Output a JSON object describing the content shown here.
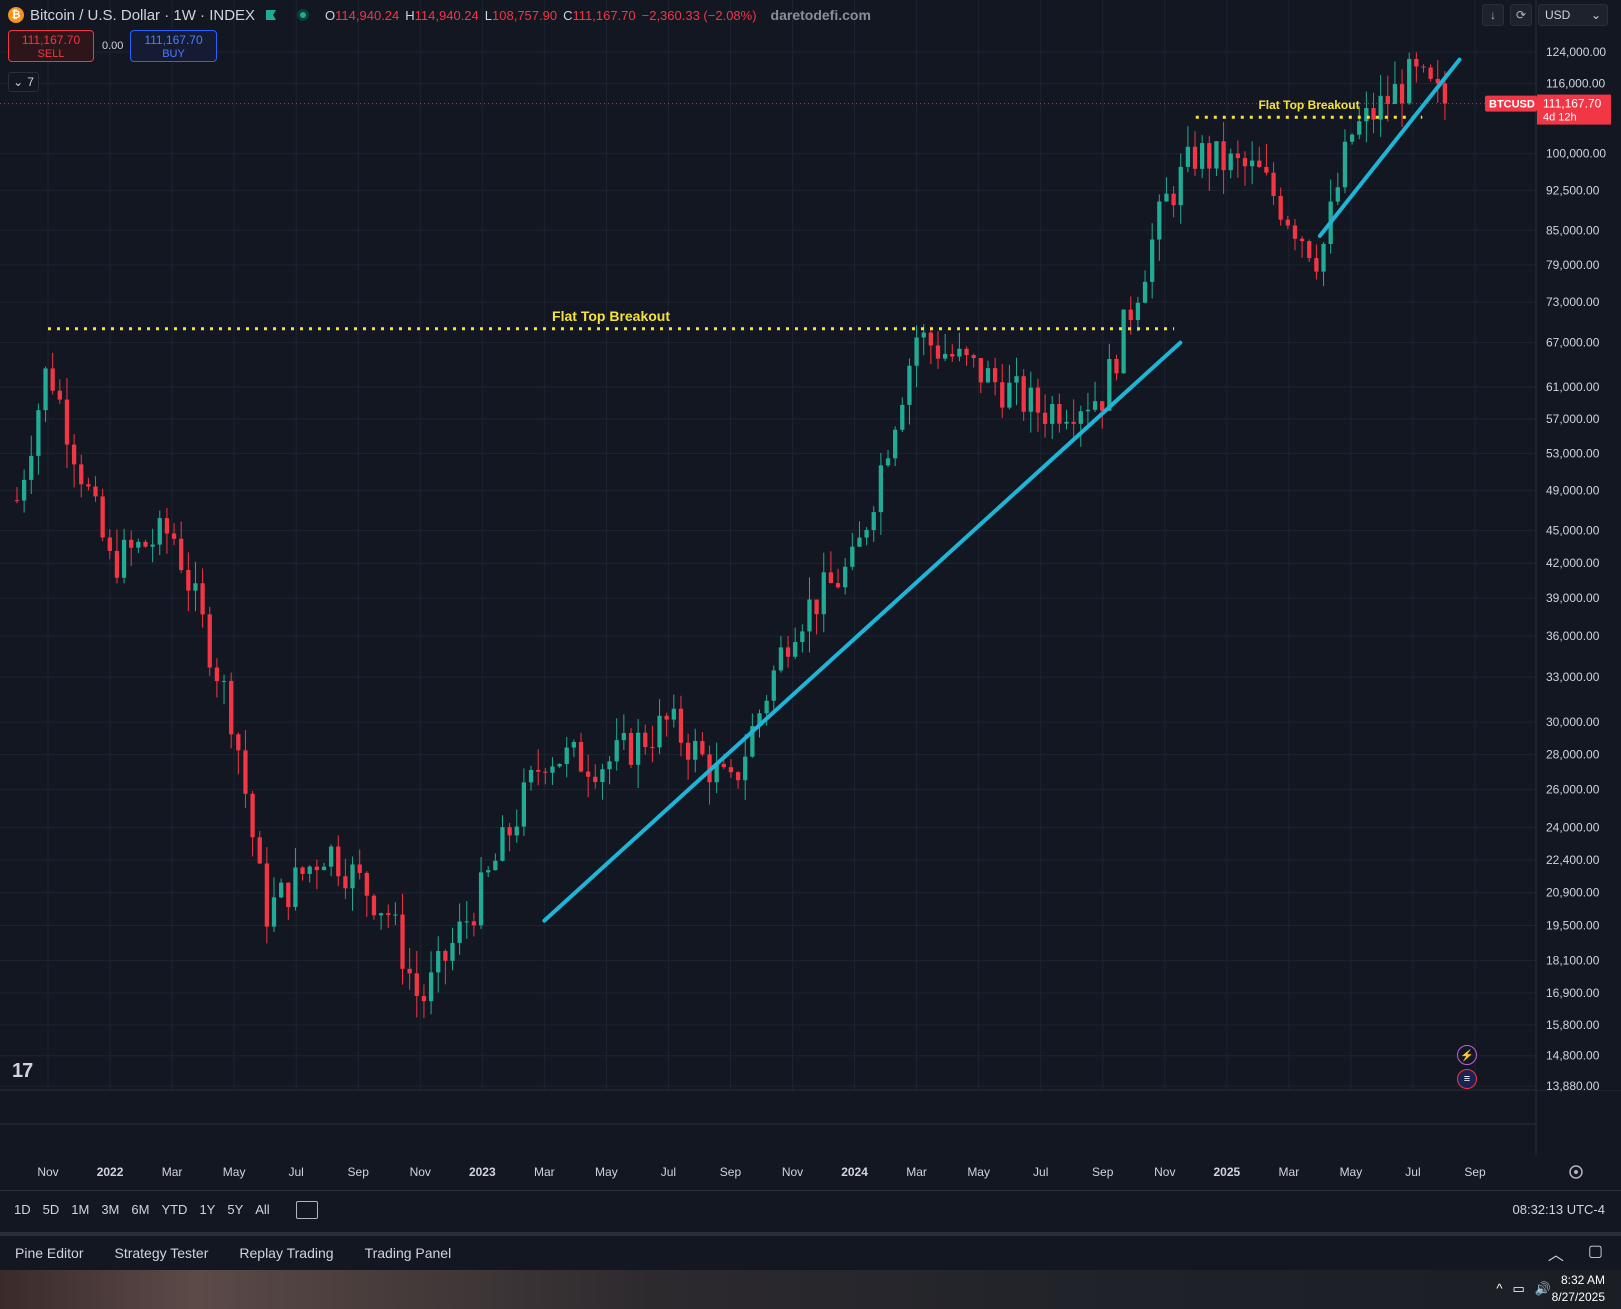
{
  "header": {
    "btc_icon_glyph": "₿",
    "symbol_title": "Bitcoin / U.S. Dollar · 1W · INDEX",
    "ohlc": [
      {
        "k": "O",
        "v": "114,940.24"
      },
      {
        "k": "H",
        "v": "114,940.24"
      },
      {
        "k": "L",
        "v": "108,757.90"
      },
      {
        "k": "C",
        "v": "111,167.70"
      },
      {
        "k": "",
        "v": "−2,360.33 (−2.08%)"
      }
    ],
    "watermark": "daretodefi.com"
  },
  "trade": {
    "sell_price": "111,167.70",
    "sell_label": "SELL",
    "spread": "0.00",
    "buy_price": "111,167.70",
    "buy_label": "BUY"
  },
  "indicators_collapse": {
    "count": "7",
    "chevron": "⌄"
  },
  "top_right": {
    "download_glyph": "↓",
    "refresh_glyph": "⟳",
    "currency": "USD",
    "currency_chevron": "⌄"
  },
  "price_axis": {
    "labels": [
      "124,000.00",
      "116,000.00",
      "100,000.00",
      "92,500.00",
      "85,000.00",
      "79,000.00",
      "73,000.00",
      "67,000.00",
      "61,000.00",
      "57,000.00",
      "53,000.00",
      "49,000.00",
      "45,000.00",
      "42,000.00",
      "39,000.00",
      "36,000.00",
      "33,000.00",
      "30,000.00",
      "28,000.00",
      "26,000.00",
      "24,000.00",
      "22,400.00",
      "20,900.00",
      "19,500.00",
      "18,100.00",
      "16,900.00",
      "15,800.00",
      "14,800.00",
      "13,880.00"
    ],
    "symbol_tag": "BTCUSD",
    "last_price": "111,167.70",
    "countdown": "4d 12h"
  },
  "time_axis": {
    "labels": [
      {
        "text": "Nov",
        "year": false
      },
      {
        "text": "2022",
        "year": true
      },
      {
        "text": "Mar",
        "year": false
      },
      {
        "text": "May",
        "year": false
      },
      {
        "text": "Jul",
        "year": false
      },
      {
        "text": "Sep",
        "year": false
      },
      {
        "text": "Nov",
        "year": false
      },
      {
        "text": "2023",
        "year": true
      },
      {
        "text": "Mar",
        "year": false
      },
      {
        "text": "May",
        "year": false
      },
      {
        "text": "Jul",
        "year": false
      },
      {
        "text": "Sep",
        "year": false
      },
      {
        "text": "Nov",
        "year": false
      },
      {
        "text": "2024",
        "year": true
      },
      {
        "text": "Mar",
        "year": false
      },
      {
        "text": "May",
        "year": false
      },
      {
        "text": "Jul",
        "year": false
      },
      {
        "text": "Sep",
        "year": false
      },
      {
        "text": "Nov",
        "year": false
      },
      {
        "text": "2025",
        "year": true
      },
      {
        "text": "Mar",
        "year": false
      },
      {
        "text": "May",
        "year": false
      },
      {
        "text": "Jul",
        "year": false
      },
      {
        "text": "Sep",
        "year": false
      }
    ]
  },
  "annotations": {
    "breakout_1": "Flat Top Breakout",
    "breakout_2": "Flat Top Breakout"
  },
  "colors": {
    "up": "#22ab94",
    "down": "#f23645",
    "trendline": "#1fb5d6",
    "level": "#f5e23a",
    "background": "#131722",
    "grid": "#1e2331"
  },
  "chart_data": {
    "type": "candlestick",
    "symbol": "BTCUSD",
    "interval": "1W",
    "last_close": 111167.7,
    "scale": "log",
    "y_visible_range": [
      13880,
      124000
    ],
    "x_visible_range": [
      "2021-10",
      "2025-09"
    ],
    "resistance_levels": [
      {
        "label": "Flat Top Breakout",
        "price": 69000,
        "from": "2021-11",
        "to": "2024-11"
      },
      {
        "label": "Flat Top Breakout",
        "price": 108000,
        "from": "2024-12",
        "to": "2025-07"
      }
    ],
    "trendlines": [
      {
        "from": {
          "date": "2023-03",
          "price": 19700
        },
        "to": {
          "date": "2024-11",
          "price": 67000
        }
      },
      {
        "from": {
          "date": "2025-04",
          "price": 84000
        },
        "to": {
          "date": "2025-08",
          "price": 122000
        }
      }
    ],
    "anchors": [
      {
        "date": "2021-10",
        "price": 48000
      },
      {
        "date": "2021-11",
        "price": 64000
      },
      {
        "date": "2022-01",
        "price": 42000
      },
      {
        "date": "2022-03",
        "price": 45000
      },
      {
        "date": "2022-05",
        "price": 30000
      },
      {
        "date": "2022-06",
        "price": 20000
      },
      {
        "date": "2022-08",
        "price": 23000
      },
      {
        "date": "2022-10",
        "price": 20000
      },
      {
        "date": "2022-11",
        "price": 16500
      },
      {
        "date": "2023-01",
        "price": 21000
      },
      {
        "date": "2023-03",
        "price": 28000
      },
      {
        "date": "2023-05",
        "price": 27500
      },
      {
        "date": "2023-07",
        "price": 30000
      },
      {
        "date": "2023-09",
        "price": 26000
      },
      {
        "date": "2023-11",
        "price": 37000
      },
      {
        "date": "2024-01",
        "price": 42000
      },
      {
        "date": "2024-03",
        "price": 68000
      },
      {
        "date": "2024-05",
        "price": 63000
      },
      {
        "date": "2024-07",
        "price": 58000
      },
      {
        "date": "2024-09",
        "price": 60000
      },
      {
        "date": "2024-11",
        "price": 90000
      },
      {
        "date": "2024-12",
        "price": 100000
      },
      {
        "date": "2025-02",
        "price": 96000
      },
      {
        "date": "2025-04",
        "price": 80000
      },
      {
        "date": "2025-05",
        "price": 104000
      },
      {
        "date": "2025-07",
        "price": 118000
      },
      {
        "date": "2025-08",
        "price": 111167
      }
    ]
  },
  "range_bar": {
    "ranges": [
      "1D",
      "5D",
      "1M",
      "3M",
      "6M",
      "YTD",
      "1Y",
      "5Y",
      "All"
    ],
    "clock": "08:32:13 UTC-4"
  },
  "panel_bar": {
    "tabs": [
      "Pine Editor",
      "Strategy Tester",
      "Replay Trading",
      "Trading Panel"
    ],
    "collapse_glyph": "︿",
    "maximize_glyph": "▢"
  },
  "taskbar": {
    "time": "8:32 AM",
    "date": "8/27/2025",
    "tray_glyphs": [
      "^",
      "▭",
      "🔊"
    ]
  },
  "logo": "17"
}
